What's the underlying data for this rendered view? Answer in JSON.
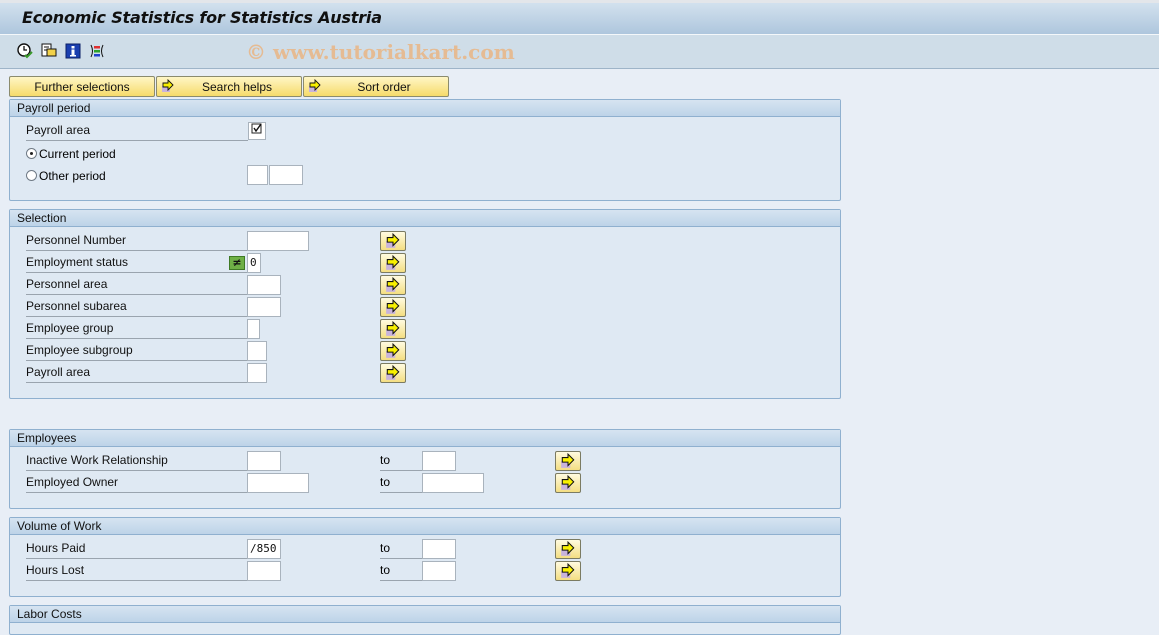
{
  "window": {
    "title": "Economic Statistics for Statistics Austria",
    "watermark": "© www.tutorialkart.com"
  },
  "toolbar": {
    "icons": [
      "execute-clock-icon",
      "variant-copy-icon",
      "info-icon",
      "selection-options-icon"
    ]
  },
  "button_bar": {
    "further_selections": "Further selections",
    "search_helps": "Search helps",
    "sort_order": "Sort order"
  },
  "payroll_period": {
    "title": "Payroll period",
    "payroll_area_label": "Payroll area",
    "payroll_area_checked": true,
    "current_period_label": "Current period",
    "other_period_label": "Other period",
    "selected": "current_period",
    "other_period_value1": "",
    "other_period_value2": ""
  },
  "selection": {
    "title": "Selection",
    "rows": [
      {
        "label": "Personnel Number",
        "value": ""
      },
      {
        "label": "Employment status",
        "value": "0",
        "operator": "≠"
      },
      {
        "label": "Personnel area",
        "value": ""
      },
      {
        "label": "Personnel subarea",
        "value": ""
      },
      {
        "label": "Employee group",
        "value": ""
      },
      {
        "label": "Employee subgroup",
        "value": ""
      },
      {
        "label": "Payroll area",
        "value": ""
      }
    ]
  },
  "employees": {
    "title": "Employees",
    "rows": [
      {
        "label": "Inactive Work Relationship",
        "from": "",
        "to_label": "to",
        "to": ""
      },
      {
        "label": "Employed Owner",
        "from": "",
        "to_label": "to",
        "to": ""
      }
    ]
  },
  "volume_of_work": {
    "title": "Volume of Work",
    "rows": [
      {
        "label": "Hours Paid",
        "from": "/850",
        "to_label": "to",
        "to": ""
      },
      {
        "label": "Hours Lost",
        "from": "",
        "to_label": "to",
        "to": ""
      }
    ]
  },
  "labor_costs": {
    "title": "Labor Costs"
  }
}
